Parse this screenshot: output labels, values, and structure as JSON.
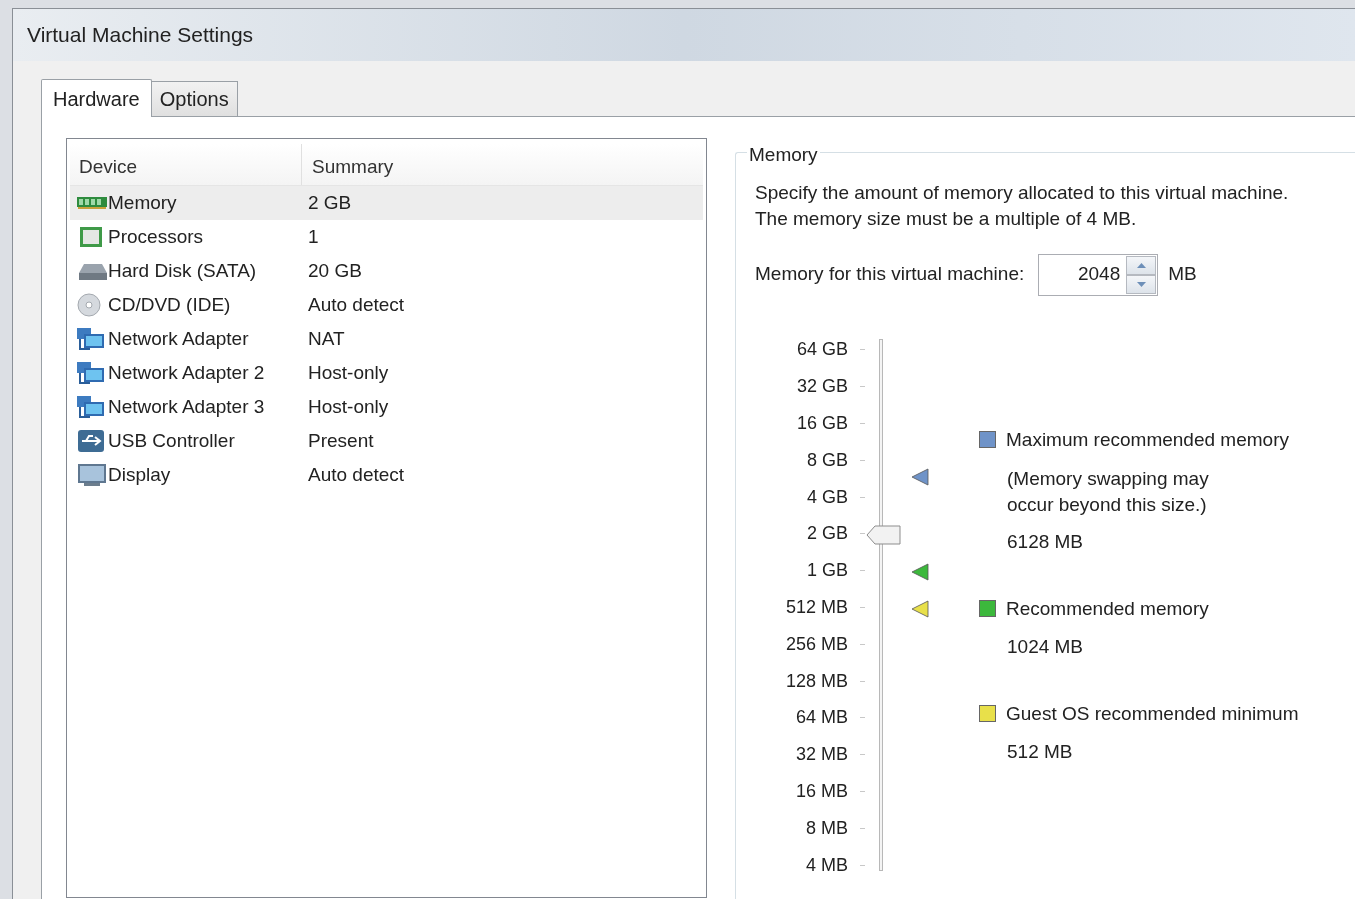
{
  "window": {
    "title": "Virtual Machine Settings"
  },
  "tabs": [
    {
      "label": "Hardware",
      "selected": true
    },
    {
      "label": "Options",
      "selected": false
    }
  ],
  "device_table": {
    "columns": [
      "Device",
      "Summary"
    ],
    "rows": [
      {
        "device": "Memory",
        "summary": "2 GB",
        "kind": "memory",
        "selected": true
      },
      {
        "device": "Processors",
        "summary": "1",
        "kind": "processor",
        "selected": false
      },
      {
        "device": "Hard Disk (SATA)",
        "summary": "20 GB",
        "kind": "disk",
        "selected": false
      },
      {
        "device": "CD/DVD (IDE)",
        "summary": "Auto detect",
        "kind": "cd",
        "selected": false
      },
      {
        "device": "Network Adapter",
        "summary": "NAT",
        "kind": "network",
        "selected": false
      },
      {
        "device": "Network Adapter 2",
        "summary": "Host-only",
        "kind": "network",
        "selected": false
      },
      {
        "device": "Network Adapter 3",
        "summary": "Host-only",
        "kind": "network",
        "selected": false
      },
      {
        "device": "USB Controller",
        "summary": "Present",
        "kind": "usb",
        "selected": false
      },
      {
        "device": "Display",
        "summary": "Auto detect",
        "kind": "display",
        "selected": false
      }
    ]
  },
  "memory": {
    "group_title": "Memory",
    "description": "Specify the amount of memory allocated to this virtual machine. The memory size must be a multiple of 4 MB.",
    "field_label": "Memory for this virtual machine:",
    "field_value": "2048",
    "unit": "MB",
    "slider": {
      "level": 0.643,
      "markers": [
        {
          "level": 0.756,
          "color": "#6f93c8"
        },
        {
          "level": 0.571,
          "color": "#3cb83c"
        },
        {
          "level": 0.5,
          "color": "#e8e04a"
        }
      ],
      "ticks": [
        "64 GB",
        "32 GB",
        "16 GB",
        "8 GB",
        "4 GB",
        "2 GB",
        "1 GB",
        "512 MB",
        "256 MB",
        "128 MB",
        "64 MB",
        "32 MB",
        "16 MB",
        "8 MB",
        "4 MB"
      ]
    },
    "legend": [
      {
        "label": "Maximum recommended memory",
        "note": "(Memory swapping may occur beyond this size.)",
        "value": "6128 MB",
        "color": "#6f93c8"
      },
      {
        "label": "Recommended memory",
        "value": "1024 MB",
        "color": "#3cb83c"
      },
      {
        "label": "Guest OS recommended minimum",
        "value": "512 MB",
        "color": "#e8e04a"
      }
    ]
  }
}
